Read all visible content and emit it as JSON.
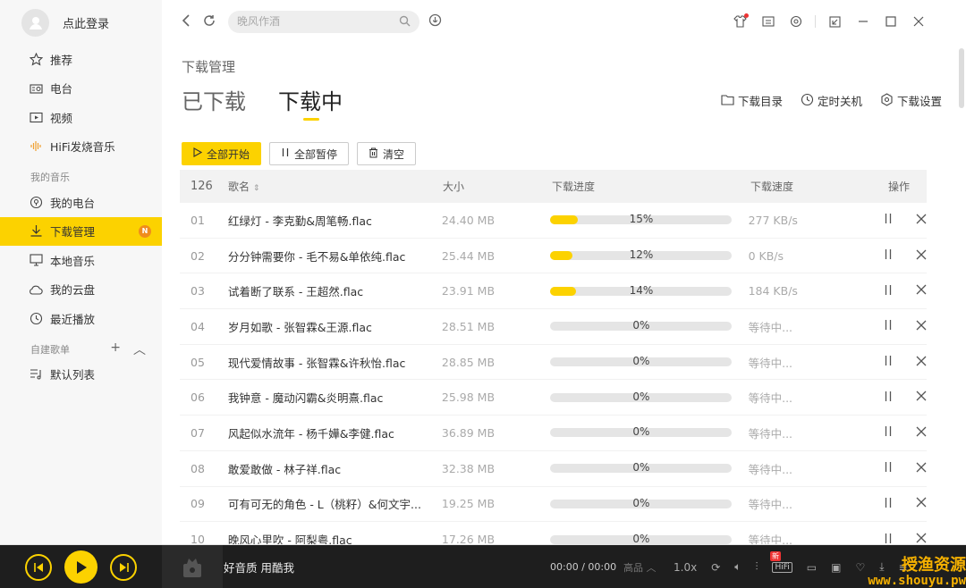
{
  "user": {
    "login_text": "点此登录"
  },
  "sidebar": {
    "items": [
      {
        "label": "推荐",
        "icon": "star-icon"
      },
      {
        "label": "电台",
        "icon": "radio-icon"
      },
      {
        "label": "视频",
        "icon": "video-icon"
      },
      {
        "label": "HiFi发烧音乐",
        "icon": "hifi-wave-icon"
      }
    ],
    "section_my_music": "我的音乐",
    "my_items": [
      {
        "label": "我的电台",
        "icon": "my-radio-icon"
      },
      {
        "label": "下载管理",
        "icon": "download-icon",
        "active": true,
        "badge": "N"
      },
      {
        "label": "本地音乐",
        "icon": "monitor-icon"
      },
      {
        "label": "我的云盘",
        "icon": "cloud-icon"
      },
      {
        "label": "最近播放",
        "icon": "clock-icon"
      }
    ],
    "section_playlists": "自建歌单",
    "playlist_items": [
      {
        "label": "默认列表",
        "icon": "playlist-icon"
      }
    ]
  },
  "search": {
    "placeholder": "晚风作酒"
  },
  "page": {
    "title": "下载管理",
    "tabs": [
      {
        "label": "已下载"
      },
      {
        "label": "下载中",
        "active": true
      }
    ],
    "actions": {
      "dir": "下载目录",
      "shutdown": "定时关机",
      "settings": "下载设置"
    },
    "buttons": {
      "start_all": "全部开始",
      "pause_all": "全部暂停",
      "clear": "清空"
    }
  },
  "table": {
    "headers": {
      "count": "126",
      "name": "歌名",
      "size": "大小",
      "progress": "下载进度",
      "speed": "下载速度",
      "ops": "操作"
    },
    "rows": [
      {
        "num": "01",
        "name": "红绿灯 - 李克勤&周笔畅.flac",
        "size": "24.40 MB",
        "progress": 15,
        "progress_label": "15%",
        "speed": "277 KB/s"
      },
      {
        "num": "02",
        "name": "分分钟需要你 - 毛不易&单依纯.flac",
        "size": "25.44 MB",
        "progress": 12,
        "progress_label": "12%",
        "speed": "0 KB/s"
      },
      {
        "num": "03",
        "name": "试着断了联系 - 王超然.flac",
        "size": "23.91 MB",
        "progress": 14,
        "progress_label": "14%",
        "speed": "184 KB/s"
      },
      {
        "num": "04",
        "name": "岁月如歌 - 张智霖&王源.flac",
        "size": "28.51 MB",
        "progress": 0,
        "progress_label": "0%",
        "speed": "等待中..."
      },
      {
        "num": "05",
        "name": "现代爱情故事 - 张智霖&许秋怡.flac",
        "size": "28.85 MB",
        "progress": 0,
        "progress_label": "0%",
        "speed": "等待中..."
      },
      {
        "num": "06",
        "name": "我钟意 - 魔动闪霸&炎明熹.flac",
        "size": "25.98 MB",
        "progress": 0,
        "progress_label": "0%",
        "speed": "等待中..."
      },
      {
        "num": "07",
        "name": "风起似水流年 - 杨千嬅&李健.flac",
        "size": "36.89 MB",
        "progress": 0,
        "progress_label": "0%",
        "speed": "等待中..."
      },
      {
        "num": "08",
        "name": "敢爱敢做 - 林子祥.flac",
        "size": "32.38 MB",
        "progress": 0,
        "progress_label": "0%",
        "speed": "等待中..."
      },
      {
        "num": "09",
        "name": "可有可无的角色 - L（桃籽）&何文宇...",
        "size": "19.25 MB",
        "progress": 0,
        "progress_label": "0%",
        "speed": "等待中..."
      },
      {
        "num": "10",
        "name": "晚风心里吹 - 阿梨粤.flac",
        "size": "17.26 MB",
        "progress": 0,
        "progress_label": "0%",
        "speed": "等待中..."
      }
    ]
  },
  "player": {
    "song_label": "好音质 用酷我",
    "time": "00:00 / 00:00",
    "quality": "高品",
    "speed": "1.0x",
    "new_badge": "新",
    "hifi": "HiFi"
  },
  "watermark": {
    "cn": "授渔资源",
    "url": "www.shouyu.pw"
  }
}
